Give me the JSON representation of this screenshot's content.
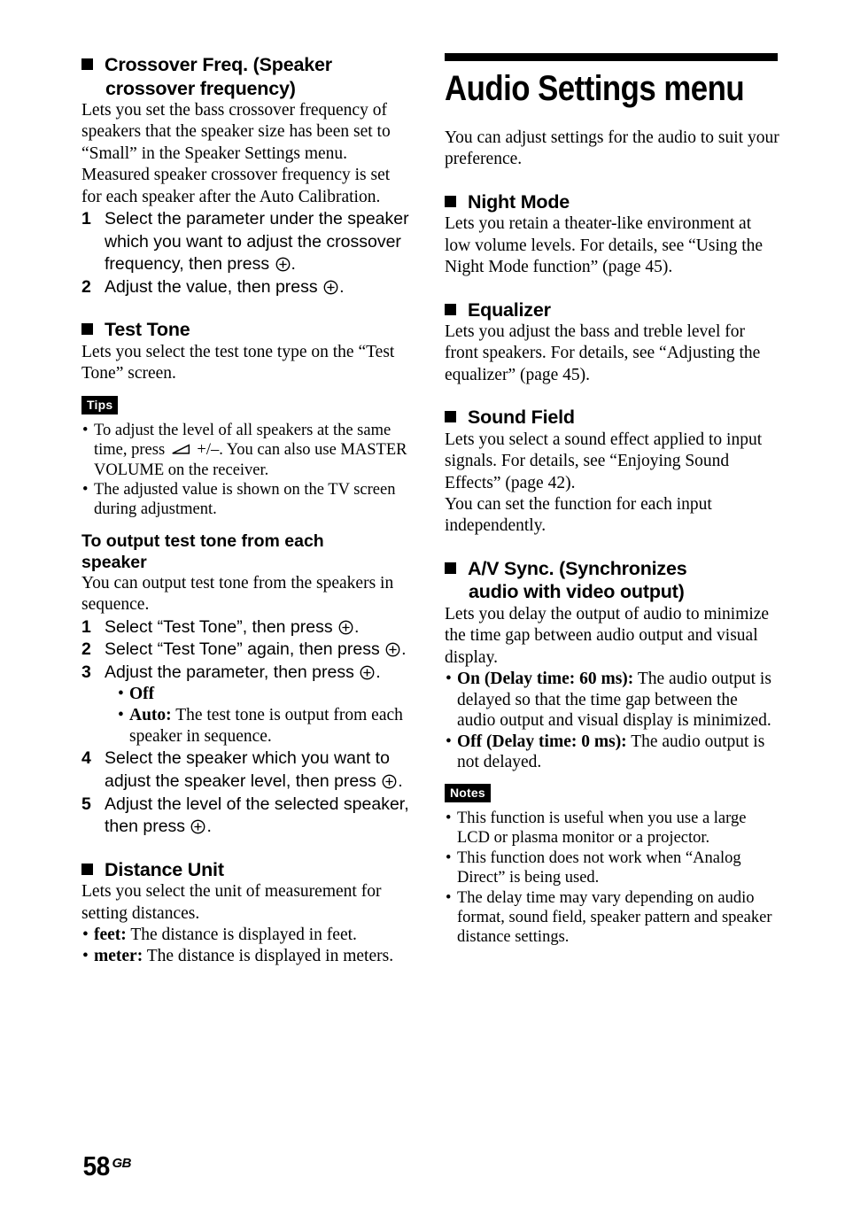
{
  "page": {
    "number": "58",
    "region_code": "GB"
  },
  "icons": {
    "enter_button": "circle-plus-enter-icon",
    "volume": "volume-wedge-icon",
    "section_square": "black-square-bullet"
  },
  "left_column": {
    "crossover": {
      "heading_line1": "Crossover Freq. (Speaker",
      "heading_line2": "crossover frequency)",
      "body": "Lets you set the bass crossover frequency of speakers that the speaker size has been set to “Small” in the Speaker Settings menu. Measured speaker crossover frequency is set for each speaker after the Auto Calibration.",
      "steps": [
        {
          "num": "1",
          "before": "Select the parameter under the speaker which you want to adjust the crossover frequency, then press ",
          "after": "."
        },
        {
          "num": "2",
          "before": "Adjust the value, then press ",
          "after": "."
        }
      ]
    },
    "test_tone": {
      "heading": "Test Tone",
      "body": "Lets you select the test tone type on the “Test Tone” screen.",
      "tips_badge": "Tips",
      "tips": [
        {
          "part1": "To adjust the level of all speakers at the same time, press ",
          "part2": " +/–. You can also use MASTER VOLUME on the receiver."
        },
        {
          "part1": "The adjusted value is shown on the TV screen during adjustment.",
          "part2": ""
        }
      ],
      "sub_heading_line1": "To output test tone from each",
      "sub_heading_line2": "speaker",
      "sub_body": "You can output test tone from the speakers in sequence.",
      "steps": [
        {
          "num": "1",
          "before": "Select “Test Tone”, then press ",
          "after": "."
        },
        {
          "num": "2",
          "before": "Select “Test Tone” again, then press ",
          "after": "."
        },
        {
          "num": "3",
          "before": "Adjust the parameter, then press ",
          "after": "."
        },
        {
          "num": "4",
          "before": "Select the speaker which you want to adjust the speaker level, then press ",
          "after": "."
        },
        {
          "num": "5",
          "before": "Adjust the level of the selected speaker, then press ",
          "after": "."
        }
      ],
      "step3_options": [
        {
          "term": "Off",
          "desc": ""
        },
        {
          "term": "Auto:",
          "desc": " The test tone is output from each speaker in sequence."
        }
      ]
    },
    "distance_unit": {
      "heading": "Distance Unit",
      "body": "Lets you select the unit of measurement for setting distances.",
      "options": [
        {
          "term": "feet:",
          "desc": " The distance is displayed in feet."
        },
        {
          "term": "meter:",
          "desc": " The distance is displayed in meters."
        }
      ]
    }
  },
  "right_column": {
    "chapter_title": "Audio Settings menu",
    "chapter_intro": "You can adjust settings for the audio to suit your preference.",
    "night_mode": {
      "heading": "Night Mode",
      "body": "Lets you retain a theater-like environment at low volume levels. For details, see “Using the Night Mode function” (page 45)."
    },
    "equalizer": {
      "heading": "Equalizer",
      "body": "Lets you adjust the bass and treble level for front speakers. For details, see “Adjusting the equalizer” (page 45)."
    },
    "sound_field": {
      "heading": "Sound Field",
      "body": "Lets you select a sound effect applied to input signals. For details, see “Enjoying Sound Effects” (page 42).",
      "body2": "You can set the function for each input independently."
    },
    "av_sync": {
      "heading_line1": "A/V Sync. (Synchronizes",
      "heading_line2": "audio with video output)",
      "body": "Lets you delay the output of audio to minimize the time gap between audio output and visual display.",
      "options": [
        {
          "term": "On (Delay time: 60 ms):",
          "desc": " The audio output is delayed so that the time gap between the audio output and visual display is minimized."
        },
        {
          "term": "Off (Delay time: 0 ms):",
          "desc": " The audio output is not delayed."
        }
      ],
      "notes_badge": "Notes",
      "notes": [
        "This function is useful when you use a large LCD or plasma monitor or a projector.",
        "This function does not work when “Analog Direct” is being used.",
        "The delay time may vary depending on audio format, sound field, speaker pattern and speaker distance settings."
      ]
    }
  }
}
